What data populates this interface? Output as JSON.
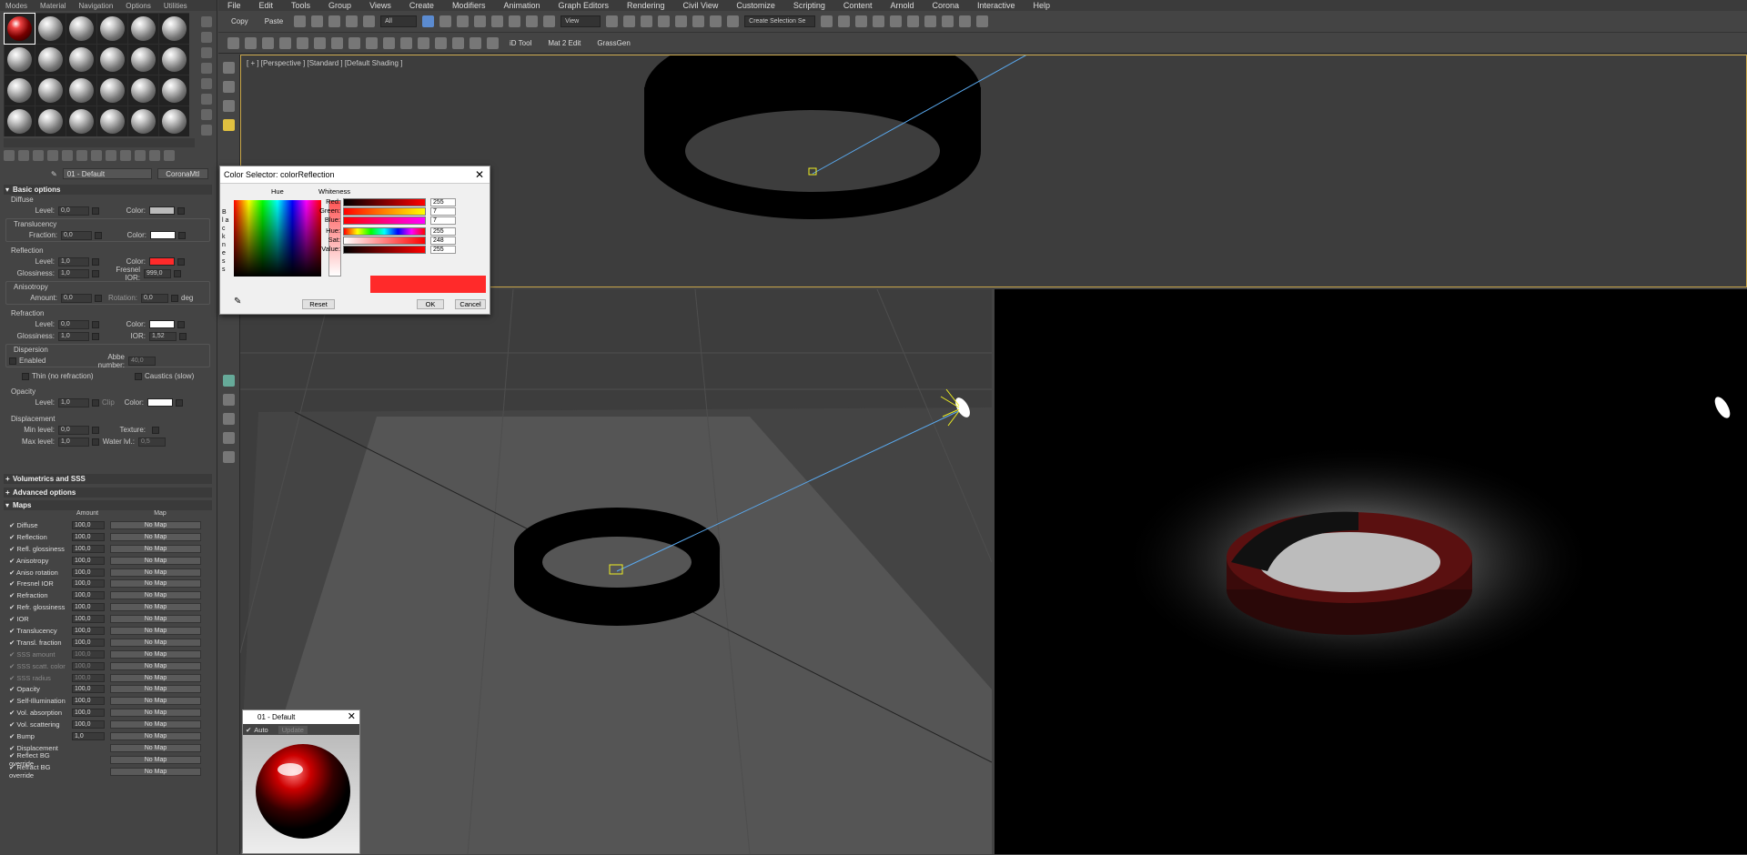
{
  "left_menu": [
    "Modes",
    "Material",
    "Navigation",
    "Options",
    "Utilities"
  ],
  "material_name": "01 - Default",
  "material_type": "CoronaMtl",
  "basic_options": {
    "header": "Basic options",
    "diffuse": {
      "section": "Diffuse",
      "level_label": "Level:",
      "level": "0,0",
      "color_label": "Color:",
      "color": "#bbbbbb"
    },
    "translucency": {
      "section": "Translucency",
      "fraction_label": "Fraction:",
      "fraction": "0,0",
      "color_label": "Color:",
      "color": "#ffffff"
    },
    "reflection": {
      "section": "Reflection",
      "level_label": "Level:",
      "level": "1,0",
      "color_label": "Color:",
      "color": "#ff2a2a",
      "gloss_label": "Glossiness:",
      "gloss": "1,0",
      "fresnel_label": "Fresnel IOR:",
      "fresnel": "999,0"
    },
    "anisotropy": {
      "section": "Anisotropy",
      "amount_label": "Amount:",
      "amount": "0,0",
      "rotation_label": "Rotation:",
      "rotation": "0,0",
      "unit": "deg"
    },
    "refraction": {
      "section": "Refraction",
      "level_label": "Level:",
      "level": "0,0",
      "color_label": "Color:",
      "color": "#ffffff",
      "gloss_label": "Glossiness:",
      "gloss": "1,0",
      "ior_label": "IOR:",
      "ior": "1,52"
    },
    "dispersion": {
      "section": "Dispersion",
      "enabled_label": "Enabled",
      "abbe_label": "Abbe number:",
      "abbe": "40,0"
    },
    "thin_label": "Thin (no refraction)",
    "caustics_label": "Caustics (slow)",
    "opacity": {
      "section": "Opacity",
      "level_label": "Level:",
      "level": "1,0",
      "clip_label": "Clip",
      "color_label": "Color:",
      "color": "#ffffff"
    },
    "displacement": {
      "section": "Displacement",
      "min_label": "Min level:",
      "min": "0,0",
      "texture_label": "Texture:",
      "max_label": "Max level:",
      "max": "1,0",
      "water_label": "Water lvl.:",
      "water": "0,5"
    }
  },
  "rollouts": [
    "Volumetrics and SSS",
    "Advanced options",
    "Maps"
  ],
  "maps_cols": {
    "amount": "Amount",
    "map": "Map"
  },
  "maps": [
    {
      "name": "Diffuse",
      "amount": "100,0",
      "map": "No Map",
      "dim": false
    },
    {
      "name": "Reflection",
      "amount": "100,0",
      "map": "No Map",
      "dim": false
    },
    {
      "name": "Refl. glossiness",
      "amount": "100,0",
      "map": "No Map",
      "dim": false
    },
    {
      "name": "Anisotropy",
      "amount": "100,0",
      "map": "No Map",
      "dim": false
    },
    {
      "name": "Aniso rotation",
      "amount": "100,0",
      "map": "No Map",
      "dim": false
    },
    {
      "name": "Fresnel IOR",
      "amount": "100,0",
      "map": "No Map",
      "dim": false
    },
    {
      "name": "Refraction",
      "amount": "100,0",
      "map": "No Map",
      "dim": false
    },
    {
      "name": "Refr. glossiness",
      "amount": "100,0",
      "map": "No Map",
      "dim": false
    },
    {
      "name": "IOR",
      "amount": "100,0",
      "map": "No Map",
      "dim": false
    },
    {
      "name": "Translucency",
      "amount": "100,0",
      "map": "No Map",
      "dim": false
    },
    {
      "name": "Transl. fraction",
      "amount": "100,0",
      "map": "No Map",
      "dim": false
    },
    {
      "name": "SSS amount",
      "amount": "100,0",
      "map": "No Map",
      "dim": true
    },
    {
      "name": "SSS scatt. color",
      "amount": "100,0",
      "map": "No Map",
      "dim": true
    },
    {
      "name": "SSS radius",
      "amount": "100,0",
      "map": "No Map",
      "dim": true
    },
    {
      "name": "Opacity",
      "amount": "100,0",
      "map": "No Map",
      "dim": false
    },
    {
      "name": "Self-Illumination",
      "amount": "100,0",
      "map": "No Map",
      "dim": false
    },
    {
      "name": "Vol. absorption",
      "amount": "100,0",
      "map": "No Map",
      "dim": false
    },
    {
      "name": "Vol. scattering",
      "amount": "100,0",
      "map": "No Map",
      "dim": false
    },
    {
      "name": "Bump",
      "amount": "1,0",
      "map": "No Map",
      "dim": false
    },
    {
      "name": "Displacement",
      "amount": "",
      "map": "No Map",
      "dim": false
    },
    {
      "name": "Reflect BG override",
      "amount": "",
      "map": "No Map",
      "dim": false
    },
    {
      "name": "Refract BG override",
      "amount": "",
      "map": "No Map",
      "dim": false
    }
  ],
  "top_menu": [
    "File",
    "Edit",
    "Tools",
    "Group",
    "Views",
    "Create",
    "Modifiers",
    "Animation",
    "Graph Editors",
    "Rendering",
    "Civil View",
    "Customize",
    "Scripting",
    "Content",
    "Arnold",
    "Corona",
    "Interactive",
    "Help"
  ],
  "toolbar": {
    "copy": "Copy",
    "paste": "Paste",
    "filter": "All",
    "refcoord": "View",
    "selset": "Create Selection Se",
    "id_tool": "iD Tool",
    "mat2edit": "Mat 2 Edit",
    "grassgen": "GrassGen"
  },
  "viewport_label": "[ + ] [Perspective ] [Standard ] [Default Shading ]",
  "color_dialog": {
    "title": "Color Selector: colorReflection",
    "hue": "Hue",
    "whiteness": "Whiteness",
    "blackness": "B l a c k n e s s",
    "channels": [
      {
        "label": "Red:",
        "value": "255"
      },
      {
        "label": "Green:",
        "value": "7"
      },
      {
        "label": "Blue:",
        "value": "7"
      },
      {
        "label": "Hue:",
        "value": "255"
      },
      {
        "label": "Sat:",
        "value": "248"
      },
      {
        "label": "Value:",
        "value": "255"
      }
    ],
    "preview_color": "#ff2a2a",
    "reset": "Reset",
    "ok": "OK",
    "cancel": "Cancel"
  },
  "mat_preview": {
    "title": "01 - Default",
    "auto": "Auto",
    "update": "Update"
  }
}
